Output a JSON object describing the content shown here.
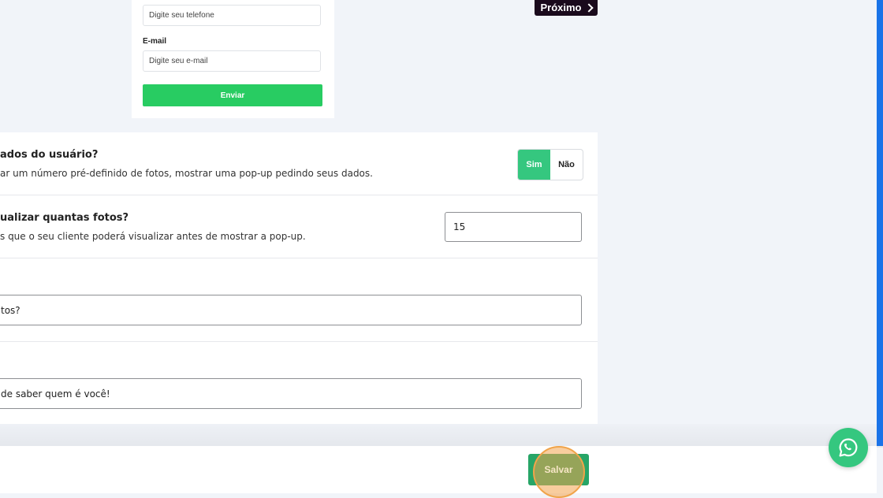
{
  "preview_form": {
    "phone_placeholder": "Digite seu telefone",
    "email_label": "E-mail",
    "email_placeholder": "Digite seu e-mail",
    "submit_label": "Enviar"
  },
  "next_button": {
    "label": "Próximo"
  },
  "settings": {
    "ask_user_data": {
      "title": "ados do usuário?",
      "description": "ar um número pré-definido de fotos, mostrar uma pop-up pedindo seus dados.",
      "toggle": {
        "yes": "Sim",
        "no": "Não",
        "selected": "Sim"
      },
      "colors": {
        "selected": "#35c77f"
      }
    },
    "photo_limit": {
      "title": "ualizar quantas fotos?",
      "description": "s que o seu cliente poderá visualizar antes de mostrar a pop-up.",
      "value": "15"
    },
    "popup_title": {
      "value": "tos?"
    },
    "popup_message": {
      "value": "de saber quem é você!"
    }
  },
  "footer": {
    "save_label": "Salvar"
  },
  "icons": {
    "whatsapp": "whatsapp-icon",
    "next": "chevron-right-icon"
  },
  "colors": {
    "accent_green": "#28cc62",
    "save_green": "#27a567",
    "scrollbar": "#1a73e8"
  }
}
